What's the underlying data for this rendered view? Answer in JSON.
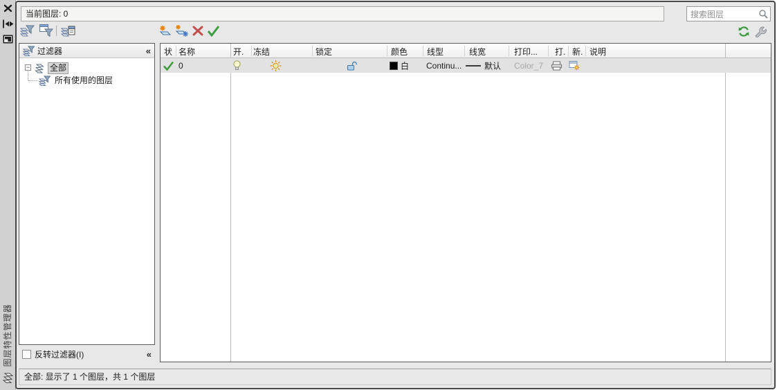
{
  "palette": {
    "vertical_title": "图层特性管理器",
    "status_text": "全部: 显示了 1 个图层，共 1 个图层"
  },
  "topbar": {
    "current_layer": "当前图层: 0",
    "search_placeholder": "搜索图层"
  },
  "glyphs": {
    "collapse": "«",
    "expander": "−"
  },
  "filter_panel": {
    "title": "过滤器",
    "nodes": [
      {
        "label": "全部"
      },
      {
        "label": "所有使用的图层"
      }
    ],
    "invert_label": "反转过滤器(I)"
  },
  "layer_table": {
    "headers": [
      "状",
      "名称",
      "开.",
      "冻结",
      "锁定",
      "颜色",
      "线型",
      "线宽",
      "打印...",
      "打.",
      "新.",
      "说明"
    ],
    "row": {
      "name": "0",
      "color_name": "白",
      "linetype": "Continu...",
      "lineweight": "默认",
      "plot_style": "Color_7"
    }
  },
  "icons": {
    "titlebar": [
      "close",
      "auto-hide",
      "properties-menu",
      "layers-stack"
    ],
    "toolbar": [
      "new-property-filter",
      "new-group-filter",
      "layer-states-manager",
      "new-layer",
      "new-layer-vp-frozen",
      "delete-layer",
      "set-current",
      "refresh",
      "settings-wrench"
    ],
    "search": "magnifier",
    "row": [
      "current-check",
      "bulb-on",
      "sun-thaw",
      "unlock",
      "printer-plot",
      "new-vp-freeze"
    ]
  },
  "colors": {
    "panel_bg": "#e9e8e8",
    "selected_row": "#e2e2e2",
    "check_green": "#3f9c3f",
    "delete_red": "#c0504d",
    "star_orange": "#e8820a",
    "layer_blue": "#3f74a8",
    "disabled_text": "#a6a6a6"
  }
}
